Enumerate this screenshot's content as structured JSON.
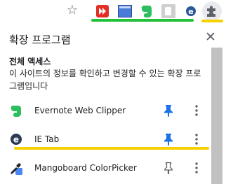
{
  "toolbar": {
    "icons": [
      "star-icon",
      "ext-red-icon",
      "ext-blue-icon",
      "evernote-icon",
      "ext-gray-icon",
      "ie-tab-icon",
      "puzzle-icon"
    ]
  },
  "popup": {
    "title": "확장 프로그램",
    "close_glyph": "✕",
    "section_title": "전체 액세스",
    "section_desc": "이 사이트의 정보를 확인하고 변경할 수 있는 확장 프로그램입니다",
    "extensions": [
      {
        "name": "Evernote Web Clipper",
        "icon": "evernote-icon",
        "pinned": true
      },
      {
        "name": "IE Tab",
        "icon": "ie-tab-icon",
        "pinned": true
      },
      {
        "name": "Mangoboard ColorPicker",
        "icon": "colorpicker-icon",
        "pinned": false
      }
    ]
  },
  "colors": {
    "pinned": "#1a73e8",
    "unpinned": "#5f6368",
    "highlight_green": "#22c13a",
    "highlight_yellow": "#f7d000"
  }
}
